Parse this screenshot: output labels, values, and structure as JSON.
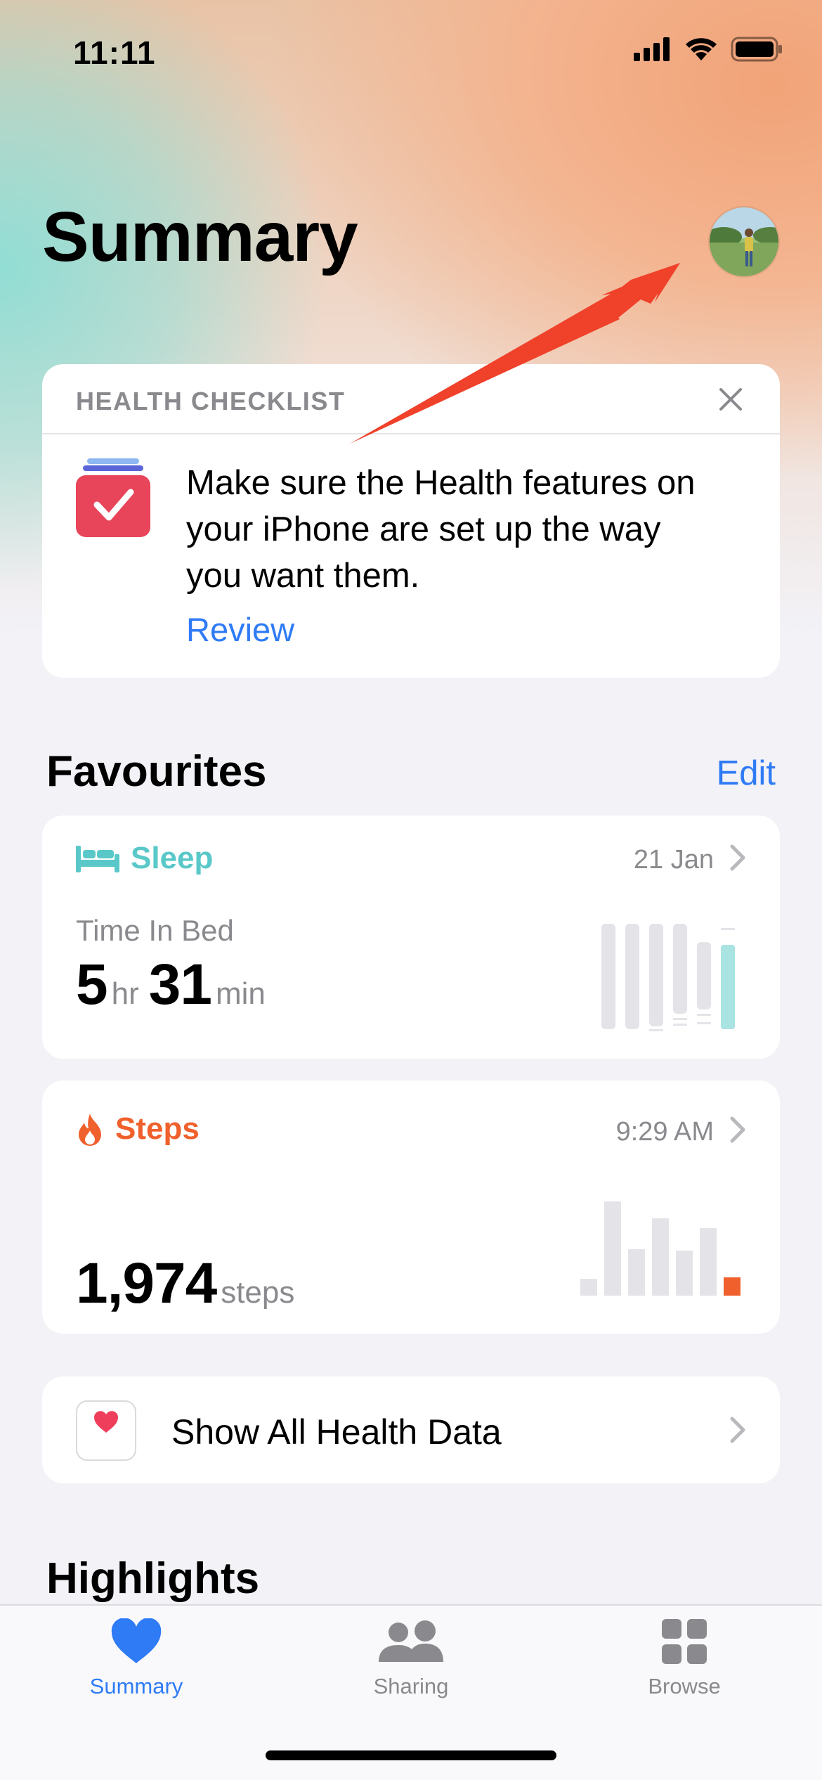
{
  "status_bar": {
    "time": "11:11"
  },
  "header": {
    "title": "Summary"
  },
  "checklist": {
    "title": "HEALTH CHECKLIST",
    "body_line1": "Make sure the Health features on",
    "body_line2": "your iPhone are set up the way",
    "body_line3": "you want them.",
    "action": "Review"
  },
  "favourites": {
    "title": "Favourites",
    "edit_label": "Edit",
    "sleep": {
      "title": "Sleep",
      "date": "21 Jan",
      "metric_label": "Time In Bed",
      "hours": "5",
      "hours_unit": "hr",
      "minutes": "31",
      "minutes_unit": "min",
      "color": "#5ac8c8"
    },
    "steps": {
      "title": "Steps",
      "time": "9:29 AM",
      "value": "1,974",
      "unit": "steps",
      "color": "#f0602c"
    }
  },
  "show_all": {
    "label": "Show All Health Data"
  },
  "highlights": {
    "title": "Highlights"
  },
  "tabs": [
    {
      "label": "Summary",
      "icon": "heart-icon",
      "active": true
    },
    {
      "label": "Sharing",
      "icon": "people-icon",
      "active": false
    },
    {
      "label": "Browse",
      "icon": "grid-icon",
      "active": false
    }
  ],
  "colors": {
    "accent": "#2f7bf5",
    "checklist_icon": "#e8455a"
  }
}
